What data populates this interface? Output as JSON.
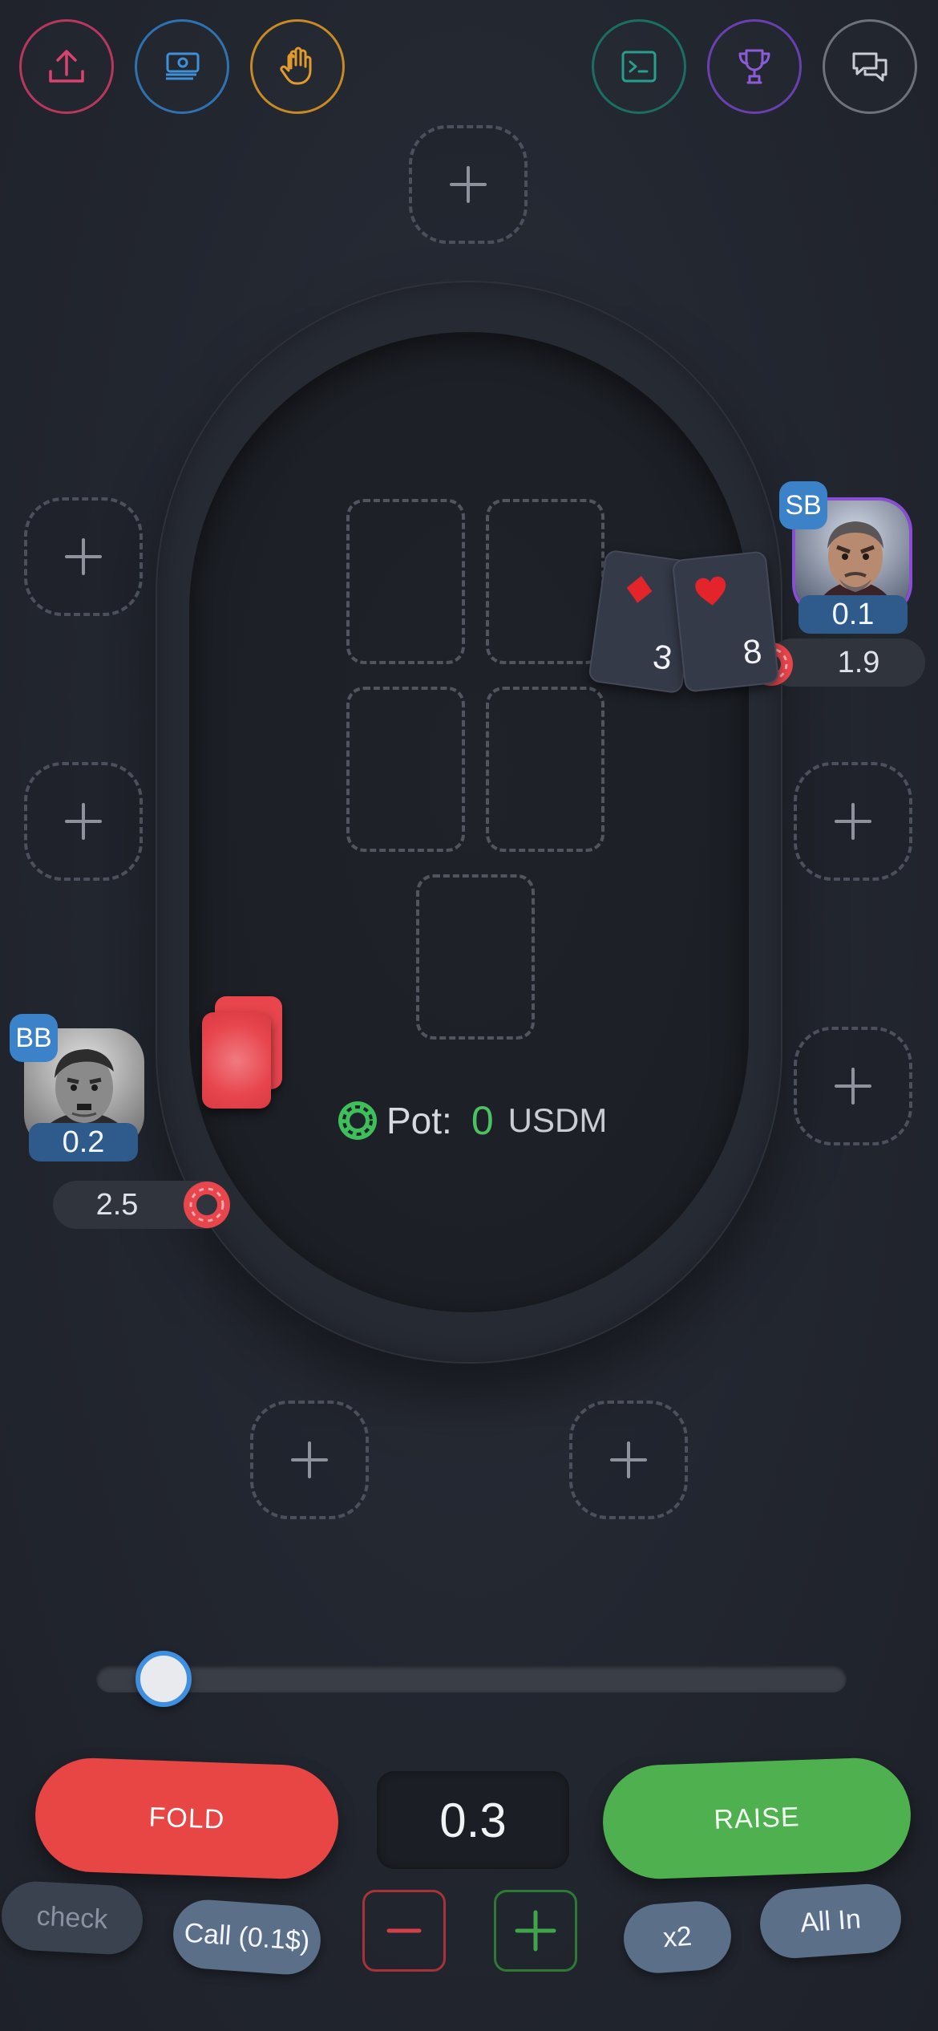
{
  "toolbar": {
    "left": [
      {
        "icon": "upload-icon",
        "color": "#d9436e"
      },
      {
        "icon": "money-icon",
        "color": "#3f90d8"
      },
      {
        "icon": "hand-icon",
        "color": "#e19a2c"
      }
    ],
    "right": [
      {
        "icon": "terminal-icon",
        "color": "#1f8a7a"
      },
      {
        "icon": "trophy-icon",
        "color": "#7b4bc7"
      },
      {
        "icon": "chat-icon",
        "color": "#8a8e97"
      }
    ]
  },
  "players": {
    "sb": {
      "role": "SB",
      "stack": "0.1",
      "bet": "1.9",
      "cards": [
        {
          "rank": "3",
          "suit": "diamond"
        },
        {
          "rank": "8",
          "suit": "heart"
        }
      ],
      "border_color": "#8a4dd6"
    },
    "bb": {
      "role": "BB",
      "stack": "0.2",
      "bet": "2.5"
    }
  },
  "pot": {
    "label": "Pot:",
    "amount": "0",
    "unit": "USDM"
  },
  "controls": {
    "fold": "FOLD",
    "raise": "RAISE",
    "amount": "0.3",
    "check": "check",
    "call": "Call (0.1$)",
    "x2": "x2",
    "all_in": "All In",
    "slider_fraction": 0.09
  },
  "colors": {
    "fold": "#e84545",
    "raise": "#4eb04f",
    "accent_blue": "#3b82c9",
    "chip_red": "#e8454d"
  }
}
